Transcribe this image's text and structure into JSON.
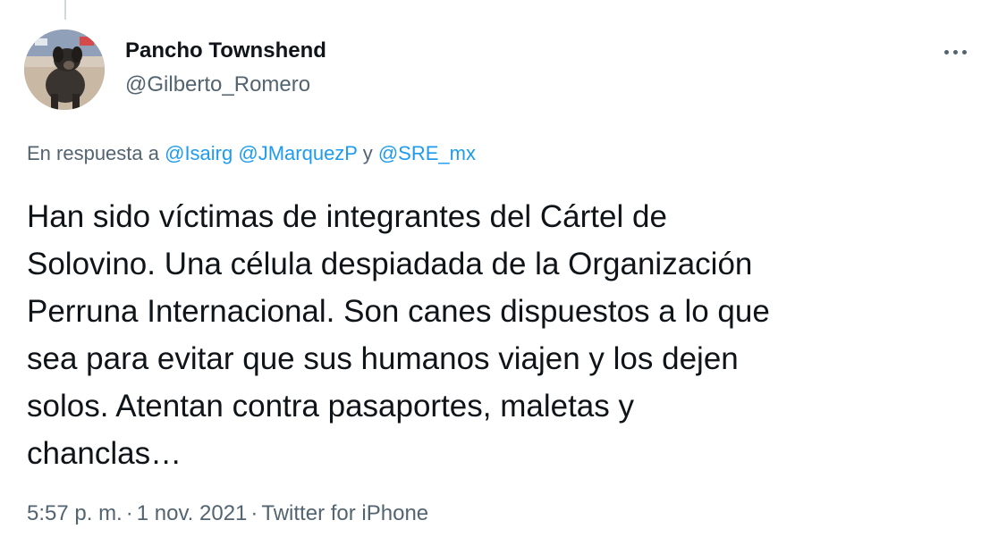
{
  "author": {
    "display_name": "Pancho Townshend",
    "handle": "@Gilberto_Romero",
    "avatar_icon": "dog-avatar"
  },
  "menu": {
    "icon": "more-dots-icon"
  },
  "reply": {
    "prefix": "En respuesta a",
    "mentions": [
      "@Isairg",
      "@JMarquezP",
      "@SRE_mx"
    ],
    "conjunction": "y"
  },
  "tweet": {
    "lines": [
      "Han sido víctimas de integrantes del Cártel de",
      "Solovino. Una célula despiadada de la Organización",
      "Perruna Internacional. Son canes dispuestos a lo que",
      "sea para evitar que sus humanos viajen y los dejen",
      "solos. Atentan contra pasaportes, maletas y",
      "chanclas…"
    ]
  },
  "meta": {
    "time": "5:57 p. m.",
    "separator": "·",
    "date": "1 nov. 2021",
    "source": "Twitter for iPhone"
  },
  "colors": {
    "link": "#1d9bf0",
    "secondary_text": "#536471",
    "primary_text": "#0f1419"
  }
}
